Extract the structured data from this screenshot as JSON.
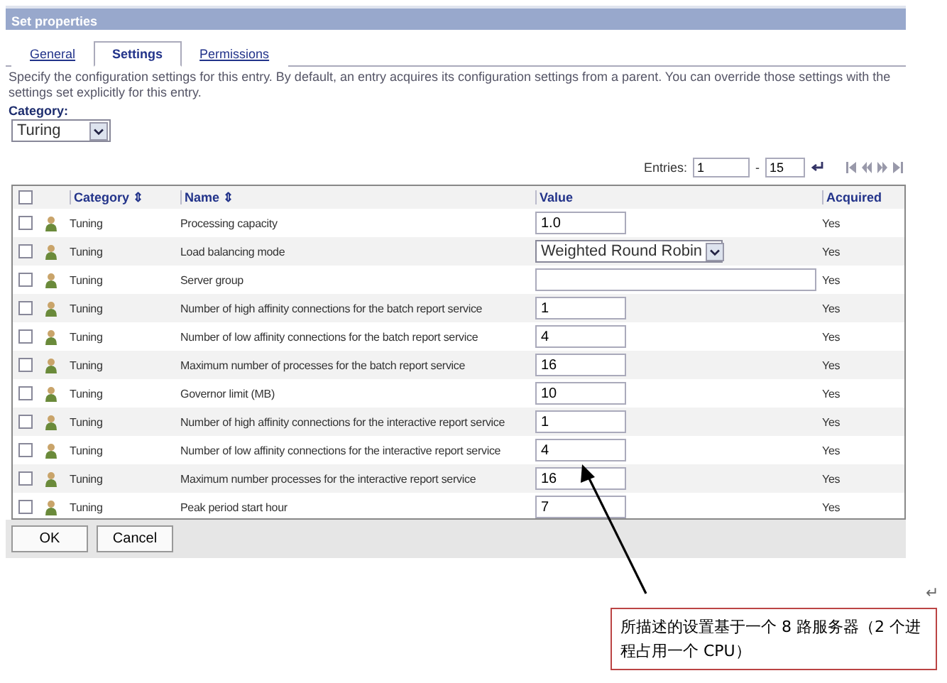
{
  "window": {
    "title": "Set properties"
  },
  "tabs": [
    {
      "label": "General",
      "selected": false
    },
    {
      "label": "Settings",
      "selected": true
    },
    {
      "label": "Permissions",
      "selected": false
    }
  ],
  "description": "Specify the configuration settings for this entry. By default, an entry acquires its configuration settings from a parent. You can override those settings with the settings set explicitly for this entry.",
  "category": {
    "label": "Category:",
    "value": "Turing"
  },
  "pager": {
    "label": "Entries:",
    "from": "1",
    "separator": "-",
    "to": "15"
  },
  "table": {
    "columns": [
      "Category ⇕",
      "Name ⇕",
      "Value",
      "Acquired"
    ],
    "header_checked": false,
    "rows": [
      {
        "category": "Tuning",
        "name": "Processing capacity",
        "kind": "text",
        "value": "1.0",
        "acquired": "Yes",
        "checked": false
      },
      {
        "category": "Tuning",
        "name": "Load balancing mode",
        "kind": "select",
        "value": "Weighted Round Robin",
        "acquired": "Yes",
        "checked": false
      },
      {
        "category": "Tuning",
        "name": "Server group",
        "kind": "wide",
        "value": "",
        "acquired": "Yes",
        "checked": false
      },
      {
        "category": "Tuning",
        "name": "Number of high affinity connections for the batch report service",
        "kind": "text",
        "value": "1",
        "acquired": "Yes",
        "checked": false
      },
      {
        "category": "Tuning",
        "name": "Number of low affinity connections for the batch report service",
        "kind": "text",
        "value": "4",
        "acquired": "Yes",
        "checked": false
      },
      {
        "category": "Tuning",
        "name": "Maximum number of processes for the batch report service",
        "kind": "text",
        "value": "16",
        "acquired": "Yes",
        "checked": false
      },
      {
        "category": "Tuning",
        "name": "Governor limit (MB)",
        "kind": "text",
        "value": "10",
        "acquired": "Yes",
        "checked": false
      },
      {
        "category": "Tuning",
        "name": "Number of high affinity connections for the interactive report service",
        "kind": "text",
        "value": "1",
        "acquired": "Yes",
        "checked": false
      },
      {
        "category": "Tuning",
        "name": "Number of low affinity connections for the interactive report service",
        "kind": "text",
        "value": "4",
        "acquired": "Yes",
        "checked": false
      },
      {
        "category": "Tuning",
        "name": "Maximum number processes for the interactive report service",
        "kind": "text",
        "value": "16",
        "acquired": "Yes",
        "checked": false
      },
      {
        "category": "Tuning",
        "name": "Peak period start hour",
        "kind": "text",
        "value": "7",
        "acquired": "Yes",
        "checked": false
      }
    ]
  },
  "buttons": [
    "OK",
    "Cancel"
  ],
  "paragraph_mark": "↵",
  "callout": "所描述的设置基于一个 8 路服务器（2 个进程占用一个 CPU）"
}
